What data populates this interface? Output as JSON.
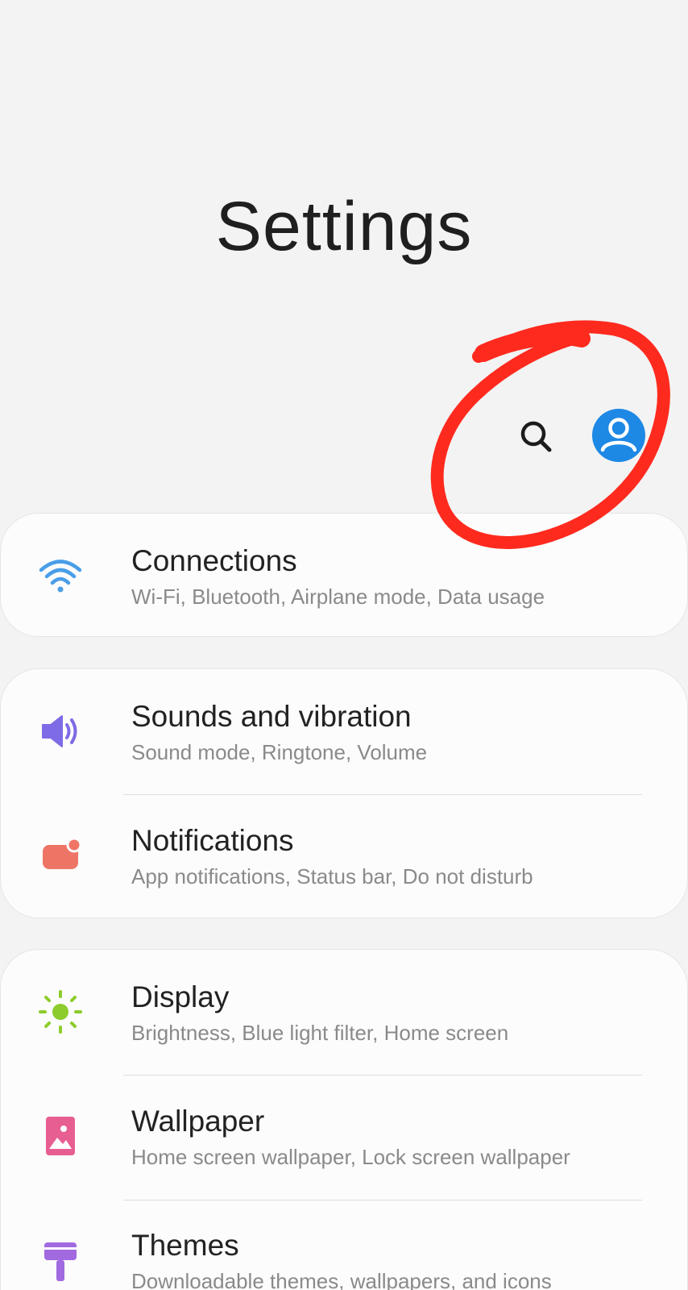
{
  "header": {
    "title": "Settings"
  },
  "actions": {
    "search_icon": "search-icon",
    "account_icon": "account-icon",
    "account_color": "#1e88e5",
    "annotation_color": "#ff2a1e"
  },
  "groups": [
    {
      "items": [
        {
          "title": "Connections",
          "subtitle": "Wi-Fi, Bluetooth, Airplane mode, Data usage",
          "icon": "wifi-icon",
          "color": "#4a9ee8"
        }
      ]
    },
    {
      "items": [
        {
          "title": "Sounds and vibration",
          "subtitle": "Sound mode, Ringtone, Volume",
          "icon": "speaker-icon",
          "color": "#7e6be6"
        },
        {
          "title": "Notifications",
          "subtitle": "App notifications, Status bar, Do not disturb",
          "icon": "notification-icon",
          "color": "#ee7566"
        }
      ]
    },
    {
      "items": [
        {
          "title": "Display",
          "subtitle": "Brightness, Blue light filter, Home screen",
          "icon": "sun-icon",
          "color": "#8ccc2c"
        },
        {
          "title": "Wallpaper",
          "subtitle": "Home screen wallpaper, Lock screen wallpaper",
          "icon": "wallpaper-icon",
          "color": "#e75e93"
        },
        {
          "title": "Themes",
          "subtitle": "Downloadable themes, wallpapers, and icons",
          "icon": "themes-icon",
          "color": "#a16ae0"
        }
      ]
    }
  ]
}
